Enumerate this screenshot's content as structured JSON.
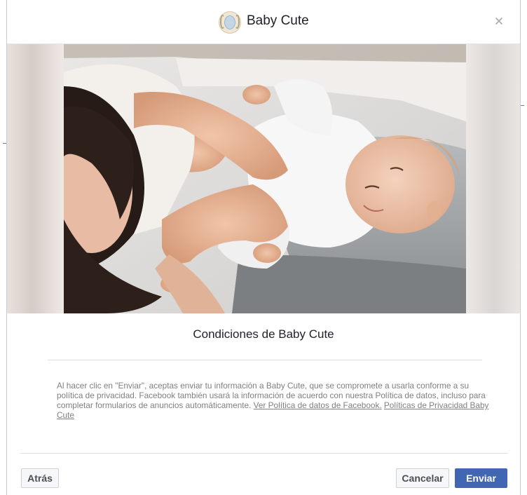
{
  "header": {
    "title": "Baby Cute",
    "logo_icon": "baby-cute-logo",
    "close_icon": "close-icon"
  },
  "hero": {
    "image": "mother-changing-baby-photo"
  },
  "conditions": {
    "title": "Condiciones de Baby Cute",
    "body": "Al hacer clic en \"Enviar\", aceptas enviar tu información a Baby Cute, que se compromete a usarla conforme a su política de privacidad. Facebook también usará la información de acuerdo con nuestra Política de datos, incluso para completar formularios de anuncios automáticamente.",
    "link_facebook_policy": "Ver Política de datos de Facebook.",
    "link_privacy": "Políticas de Privacidad Baby Cute"
  },
  "footer": {
    "back_label": "Atrás",
    "cancel_label": "Cancelar",
    "send_label": "Enviar"
  },
  "colors": {
    "primary": "#4267b2",
    "text": "#1d2129",
    "muted": "#7f7f7f"
  }
}
